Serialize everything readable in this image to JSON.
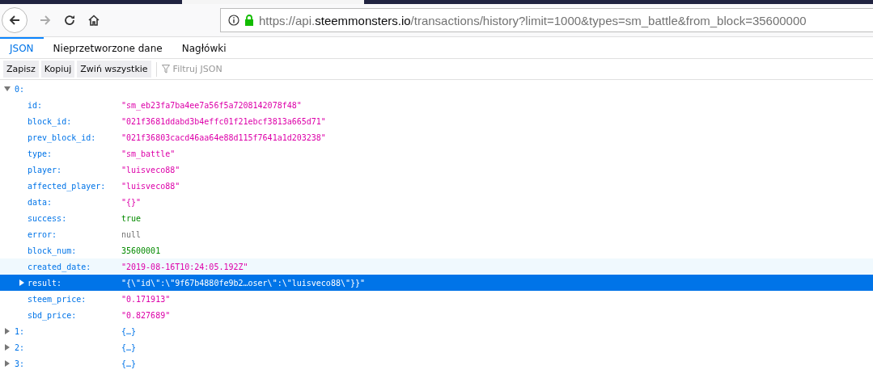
{
  "address_bar": {
    "url_prefix": "https://api.",
    "url_domain": "steemmonsters.io",
    "url_suffix": "/transactions/history?limit=1000&types=sm_battle&from_block=35600000"
  },
  "tabs": [
    {
      "label": "JSON",
      "selected": true
    },
    {
      "label": "Nieprzetworzone dane",
      "selected": false
    },
    {
      "label": "Nagłówki",
      "selected": false
    }
  ],
  "toolbar": {
    "buttons": [
      "Zapisz",
      "Kopiuj",
      "Zwiń wszystkie"
    ],
    "filter_placeholder": "Filtruj JSON"
  },
  "tree": [
    {
      "key": "0:",
      "expanded": true,
      "children": [
        {
          "key": "id:",
          "value": "\"sm_eb23fa7ba4ee7a56f5a7208142078f48\"",
          "kind": "string",
          "hovered": false,
          "selected": false
        },
        {
          "key": "block_id:",
          "value": "\"021f3681ddabd3b4effc01f21ebcf3813a665d71\"",
          "kind": "string",
          "hovered": false,
          "selected": false
        },
        {
          "key": "prev_block_id:",
          "value": "\"021f36803cacd46aa64e88d115f7641a1d203238\"",
          "kind": "string",
          "hovered": false,
          "selected": false
        },
        {
          "key": "type:",
          "value": "\"sm_battle\"",
          "kind": "string",
          "hovered": false,
          "selected": false
        },
        {
          "key": "player:",
          "value": "\"luisveco88\"",
          "kind": "string",
          "hovered": false,
          "selected": false
        },
        {
          "key": "affected_player:",
          "value": "\"luisveco88\"",
          "kind": "string",
          "hovered": false,
          "selected": false
        },
        {
          "key": "data:",
          "value": "\"{}\"",
          "kind": "string",
          "hovered": false,
          "selected": false
        },
        {
          "key": "success:",
          "value": "true",
          "kind": "boolean",
          "hovered": false,
          "selected": false
        },
        {
          "key": "error:",
          "value": "null",
          "kind": "null",
          "hovered": false,
          "selected": false
        },
        {
          "key": "block_num:",
          "value": "35600001",
          "kind": "number",
          "hovered": false,
          "selected": false
        },
        {
          "key": "created_date:",
          "value": "\"2019-08-16T10:24:05.192Z\"",
          "kind": "string",
          "hovered": true,
          "selected": false
        },
        {
          "key": "result:",
          "value": "\"{\\\"id\\\":\\\"9f67b4880fe9b2…oser\\\":\\\"luisveco88\\\"}}\"",
          "kind": "string",
          "hovered": false,
          "selected": true,
          "expanded": false
        },
        {
          "key": "steem_price:",
          "value": "\"0.171913\"",
          "kind": "string",
          "hovered": false,
          "selected": false
        },
        {
          "key": "sbd_price:",
          "value": "\"0.827689\"",
          "kind": "string",
          "hovered": false,
          "selected": false
        }
      ]
    },
    {
      "key": "1:",
      "expanded": false,
      "value": "{…}"
    },
    {
      "key": "2:",
      "expanded": false,
      "value": "{…}"
    },
    {
      "key": "3:",
      "expanded": false,
      "value": "{…}"
    }
  ]
}
